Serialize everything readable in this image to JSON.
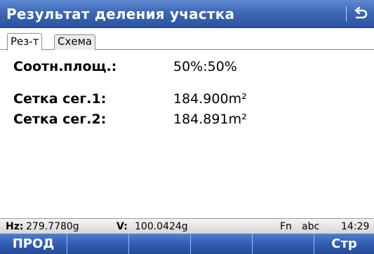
{
  "title": "Результат деления участка",
  "tabs": [
    {
      "label": "Рез-т",
      "active": true
    },
    {
      "label": "Схема",
      "active": false
    }
  ],
  "results": {
    "area_ratio": {
      "label": "Соотн.площ.:",
      "value": "50%:50%"
    },
    "segment1": {
      "label": "Сетка сег.1:",
      "value": "184.900m²"
    },
    "segment2": {
      "label": "Сетка сег.2:",
      "value": "184.891m²"
    }
  },
  "status": {
    "hz_label": "Hz:",
    "hz_value": "279.7780g",
    "v_label": "V:",
    "v_value": "100.0424g",
    "fn": "Fn",
    "input_mode": "abc",
    "time": "14:29"
  },
  "softkeys": [
    "ПРОД",
    "",
    "",
    "",
    "",
    "Стр"
  ],
  "icons": {
    "back": "back-arrow-icon"
  },
  "colors": {
    "titlebar": "#3d67b7",
    "softkeys": "#2e5bb2"
  }
}
